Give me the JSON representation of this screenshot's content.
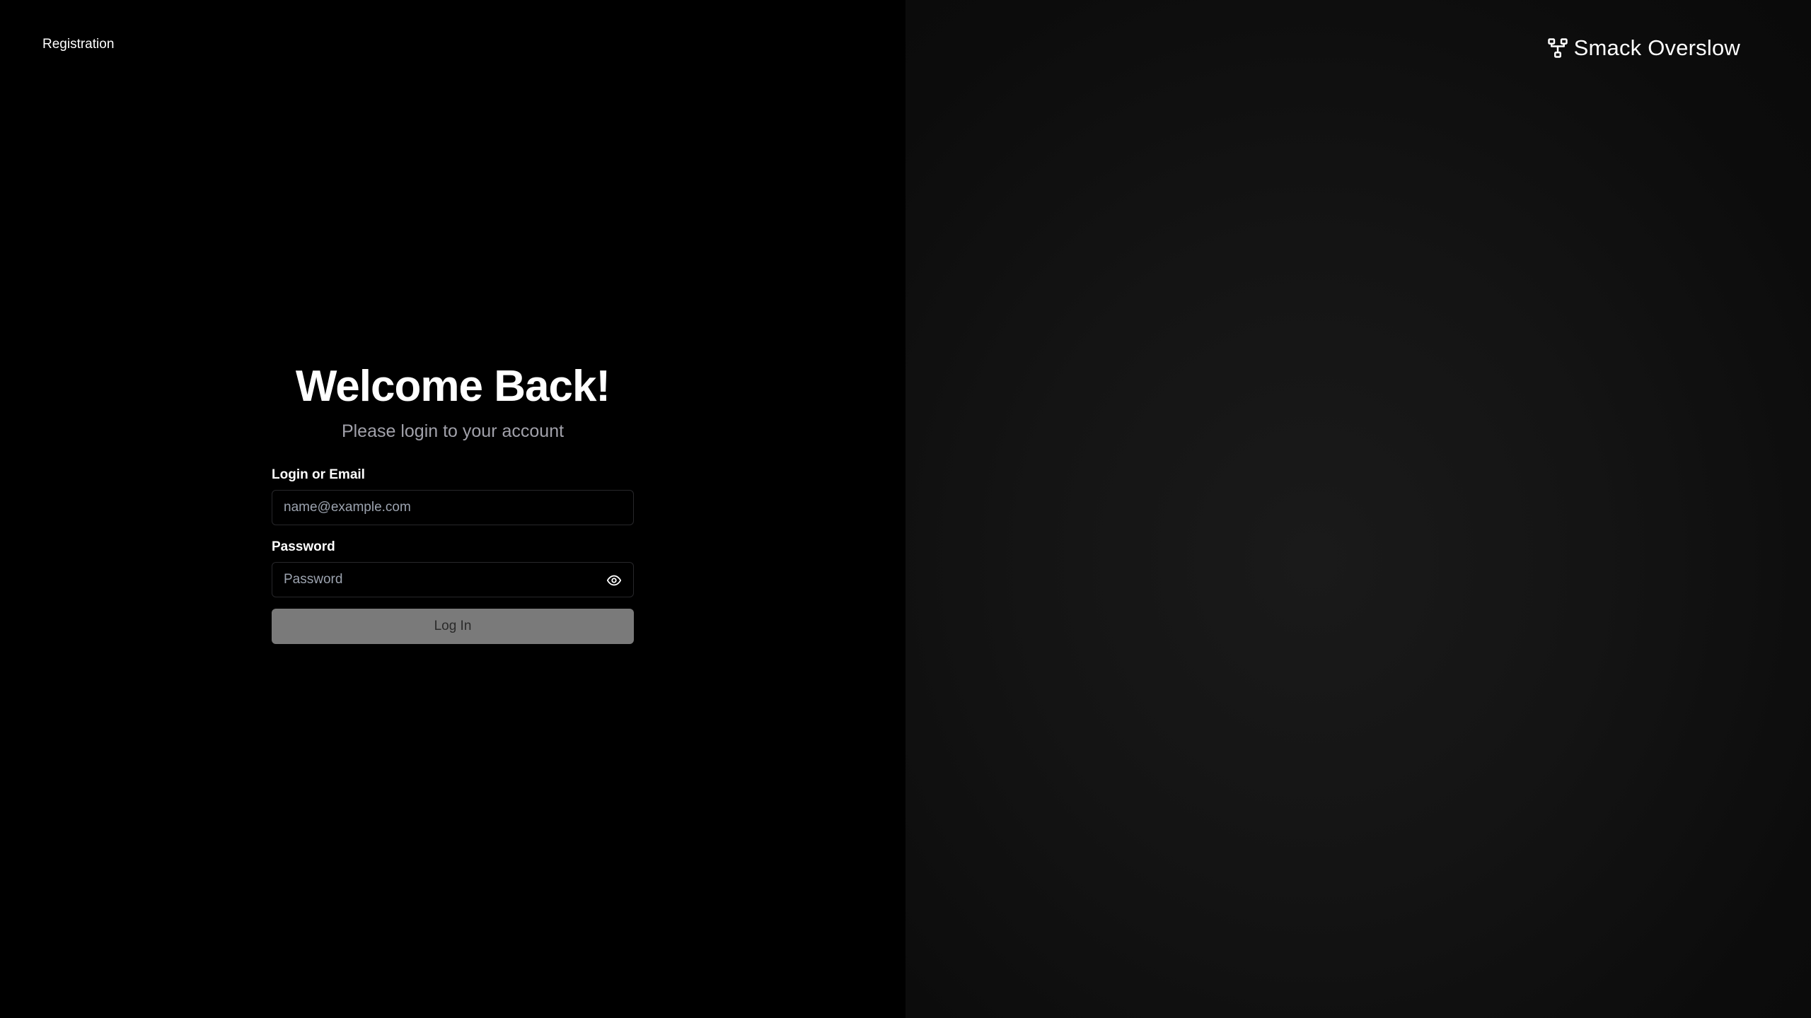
{
  "nav": {
    "registration_label": "Registration"
  },
  "brand": {
    "name": "Smack Overslow",
    "icon": "network-nodes-icon"
  },
  "login": {
    "title": "Welcome Back!",
    "subtitle": "Please login to your account",
    "email_label": "Login or Email",
    "email_placeholder": "name@example.com",
    "email_value": "",
    "password_label": "Password",
    "password_placeholder": "Password",
    "password_value": "",
    "show_password_icon": "eye-icon",
    "submit_label": "Log In"
  },
  "colors": {
    "background": "#000000",
    "right_panel": "#141414",
    "text_primary": "#ffffff",
    "text_muted": "#a1a1aa",
    "input_border": "#27272a",
    "button_disabled_bg": "#7a7a7a",
    "button_disabled_text": "#2a2a2a"
  }
}
